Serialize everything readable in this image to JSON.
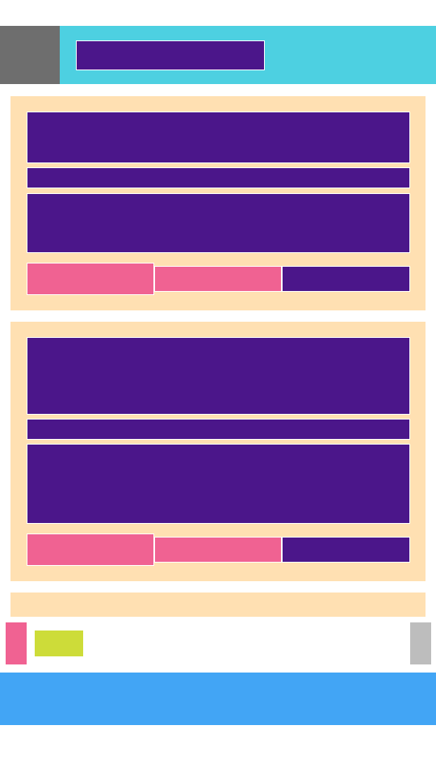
{
  "header": {
    "menu_icon": "menu-icon",
    "title": ""
  },
  "feed": {
    "cards": [
      {
        "title": "",
        "subtitle": "",
        "body": "",
        "actions": [
          {
            "label": ""
          },
          {
            "label": ""
          },
          {
            "label": ""
          }
        ]
      },
      {
        "title": "",
        "subtitle": "",
        "body": "",
        "actions": [
          {
            "label": ""
          },
          {
            "label": ""
          },
          {
            "label": ""
          }
        ]
      }
    ],
    "footer_text": ""
  },
  "bottom_bar": {
    "left_icon": "flag-icon",
    "chip_label": "",
    "right_icon": "scroll-handle-icon"
  },
  "bottom_nav": {
    "label": ""
  },
  "colors": {
    "header_bg": "#4dd0e1",
    "menu_button_bg": "#6e6e6e",
    "card_bg": "#ffe0b2",
    "content_block": "#4b168a",
    "accent_pink": "#f06292",
    "chip_lime": "#cddc39",
    "handle_gray": "#bdbdbd",
    "bottom_nav_bg": "#42a5f5"
  }
}
